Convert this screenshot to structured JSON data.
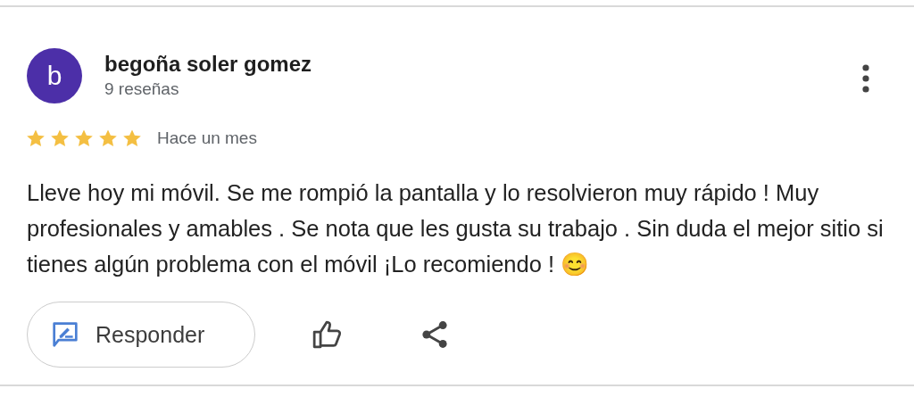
{
  "review": {
    "author": {
      "initial": "b",
      "name": "begoña soler gomez",
      "reviews_count": "9 reseñas"
    },
    "stars": 5,
    "time": "Hace un mes",
    "text": "Lleve hoy mi móvil. Se me rompió la pantalla y lo resolvieron muy rápido ! Muy profesionales y amables . Se nota que les gusta su trabajo . Sin duda el mejor sitio si tienes algún problema con el móvil ¡Lo recomiendo ! 😊",
    "actions": {
      "reply_label": "Responder"
    }
  }
}
